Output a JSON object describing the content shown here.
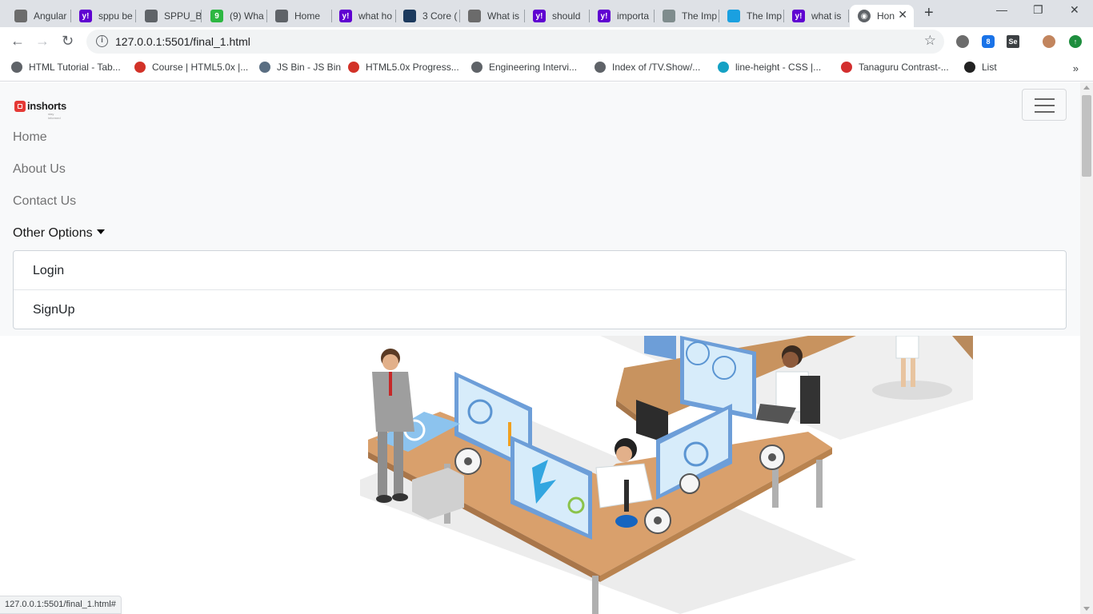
{
  "browser": {
    "tabs": [
      {
        "label": "Angular",
        "icon": "angular-icon",
        "color": "#6c6c6c"
      },
      {
        "label": "sppu be",
        "icon": "yahoo-icon",
        "color": "#5f01d1"
      },
      {
        "label": "SPPU_B",
        "icon": "globe-icon",
        "color": "#5f6368"
      },
      {
        "label": "(9) Wha",
        "icon": "whatsapp-icon",
        "color": "#2db742"
      },
      {
        "label": "Home",
        "icon": "globe-icon",
        "color": "#5f6368"
      },
      {
        "label": "what ho",
        "icon": "yahoo-icon",
        "color": "#5f01d1"
      },
      {
        "label": "3 Core (",
        "icon": "generic-icon",
        "color": "#1c3a5e"
      },
      {
        "label": "What is",
        "icon": "tree-icon",
        "color": "#6b6b6b"
      },
      {
        "label": "should",
        "icon": "yahoo-icon",
        "color": "#5f01d1"
      },
      {
        "label": "importa",
        "icon": "yahoo-icon",
        "color": "#5f01d1"
      },
      {
        "label": "The Imp",
        "icon": "eye-icon",
        "color": "#7f8c8d"
      },
      {
        "label": "The Imp",
        "icon": "diamond-icon",
        "color": "#1aa0e0"
      },
      {
        "label": "what is",
        "icon": "yahoo-icon",
        "color": "#5f01d1"
      }
    ],
    "active_tab": {
      "label": "Hon",
      "icon": "globe-icon"
    },
    "url": "127.0.0.1:5501/final_1.html",
    "bookmarks": [
      {
        "label": "HTML Tutorial - Tab...",
        "icon": "globe-icon",
        "color": "#5f6368"
      },
      {
        "label": "Course | HTML5.0x |...",
        "icon": "edx-icon",
        "color": "#d23228"
      },
      {
        "label": "JS Bin - JS Bin",
        "icon": "jsbin-icon",
        "color": "#5a6e82"
      },
      {
        "label": "HTML5.0x Progress...",
        "icon": "edx-icon",
        "color": "#d23228"
      },
      {
        "label": "Engineering Intervi...",
        "icon": "globe-icon",
        "color": "#5f6368"
      },
      {
        "label": "Index of /TV.Show/...",
        "icon": "globe-icon",
        "color": "#5f6368"
      },
      {
        "label": "line-height - CSS |...",
        "icon": "mdn-icon",
        "color": "#15a1c4"
      },
      {
        "label": "Tanaguru Contrast-...",
        "icon": "tanaguru-icon",
        "color": "#d32f2f"
      },
      {
        "label": "List",
        "icon": "codepen-icon",
        "color": "#222"
      }
    ],
    "status_url": "127.0.0.1:5501/final_1.html#"
  },
  "site": {
    "brand": "inshorts",
    "tagline": "stay informed",
    "nav": {
      "home": "Home",
      "about": "About Us",
      "contact": "Contact Us",
      "other": "Other Options"
    },
    "dropdown": {
      "login": "Login",
      "signup": "SignUp"
    }
  },
  "colors": {
    "brand_red": "#e53935",
    "navbar_bg": "#f8f9fa"
  }
}
